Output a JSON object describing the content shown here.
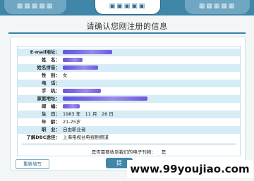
{
  "heading": "请确认您刚注册的信息",
  "fields": [
    {
      "label": "E-mail地址：",
      "value": ""
    },
    {
      "label": "姓　名：",
      "value": ""
    },
    {
      "label": "姓名拼音：",
      "value": ""
    },
    {
      "label": "性　别：",
      "value": "女"
    },
    {
      "label": "电　话：",
      "value": ""
    },
    {
      "label": "手　机：",
      "value": ""
    },
    {
      "label": "家庭地址：",
      "value": ""
    },
    {
      "label": "邮　编：",
      "value": ""
    },
    {
      "label": "生　日：",
      "value": "1983 年　11 月　26 日"
    },
    {
      "label": "年　龄：",
      "value": "21-25岁"
    },
    {
      "label": "职　业：",
      "value": "自由职业者"
    },
    {
      "label": "了解DBC途径：",
      "value": "上海电视台电视剧频道"
    }
  ],
  "newsletter_question": "是否需要收到我们的电子刊物：",
  "newsletter_answer": "是",
  "buttons": {
    "back": "重新填写",
    "submit": "提"
  },
  "watermark": "www.99youjiao.com"
}
